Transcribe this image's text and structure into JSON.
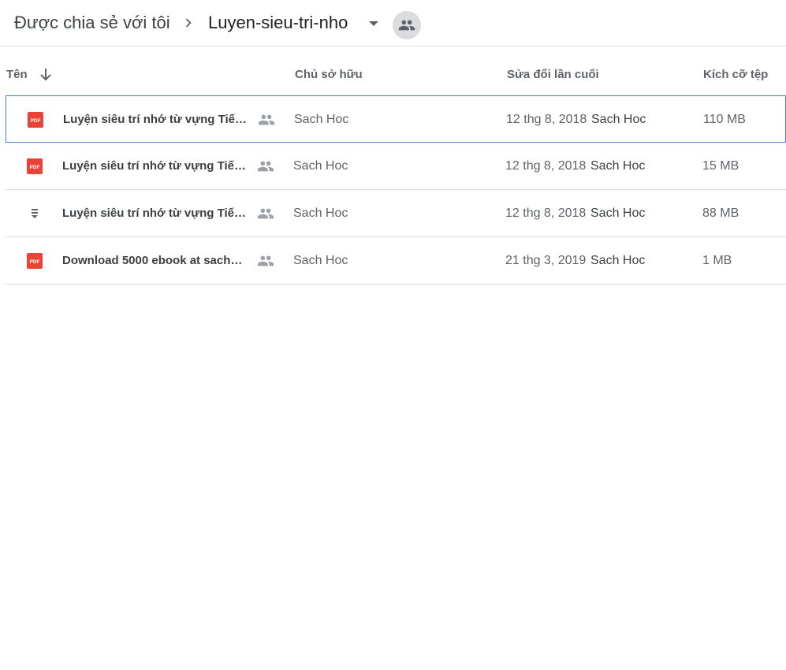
{
  "breadcrumb": {
    "root": "Được chia sẻ với tôi",
    "current": "Luyen-sieu-tri-nho"
  },
  "columns": {
    "name": "Tên",
    "owner": "Chủ sở hữu",
    "modified": "Sửa đổi lần cuối",
    "size": "Kích cỡ tệp"
  },
  "icons": {
    "breadcrumb_separator": "chevron-right-icon",
    "folder_menu": "arrow-drop-down-icon",
    "shared": "people-icon",
    "sort": "arrow-downward-icon",
    "pdf": "pdf-file-icon",
    "archive": "archive-file-icon"
  },
  "colors": {
    "pdf_red": "#ea4335",
    "selection_border": "#4a7fd4",
    "divider": "#dadce0",
    "shared_badge_bg": "#dadce0"
  },
  "files": [
    {
      "type": "pdf",
      "name": "Luyện siêu trí nhớ từ vựng Tiến…",
      "owner": "Sach Hoc",
      "modified_date": "12 thg 8, 2018",
      "modified_by": "Sach Hoc",
      "size": "110 MB",
      "selected": true
    },
    {
      "type": "pdf",
      "name": "Luyện siêu trí nhớ từ vựng Tiến…",
      "owner": "Sach Hoc",
      "modified_date": "12 thg 8, 2018",
      "modified_by": "Sach Hoc",
      "size": "15 MB",
      "selected": false
    },
    {
      "type": "archive",
      "name": "Luyện siêu trí nhớ từ vựng Tiến…",
      "owner": "Sach Hoc",
      "modified_date": "12 thg 8, 2018",
      "modified_by": "Sach Hoc",
      "size": "88 MB",
      "selected": false
    },
    {
      "type": "pdf",
      "name": "Download 5000 ebook at sach…",
      "owner": "Sach Hoc",
      "modified_date": "21 thg 3, 2019",
      "modified_by": "Sach Hoc",
      "size": "1 MB",
      "selected": false
    }
  ]
}
